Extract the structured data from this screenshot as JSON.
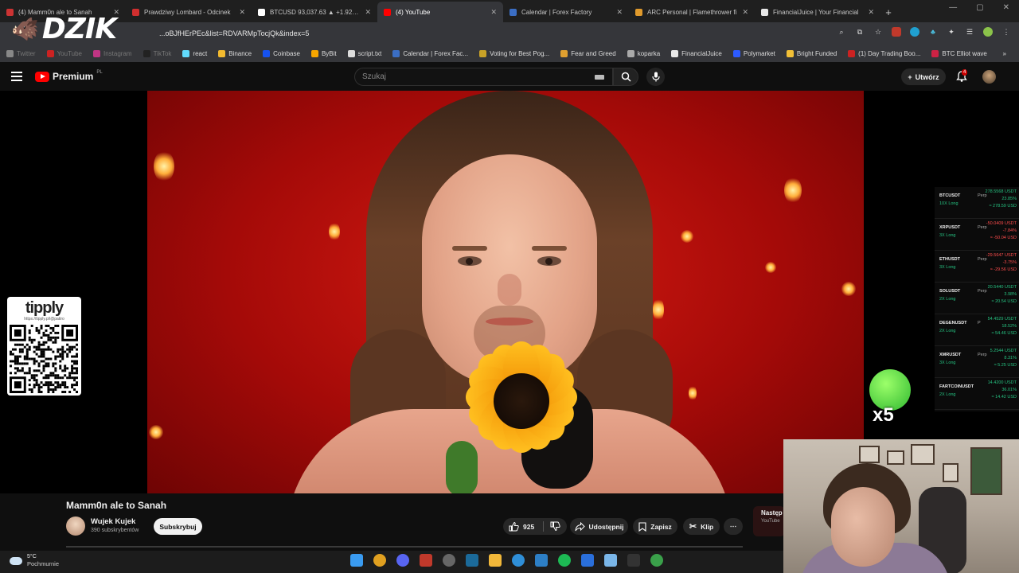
{
  "browser": {
    "tabs": [
      {
        "title": "(4) Mamm0n ale to Sanah",
        "color": "#cc3333",
        "active": false
      },
      {
        "title": "Prawdziwy Lombard - Odcinek",
        "color": "#d02f2f",
        "active": false
      },
      {
        "title": "BTCUSD 93,037.63 ▲ +1.92% B",
        "color": "#ffffff",
        "active": false
      },
      {
        "title": "(4) YouTube",
        "color": "#ff0000",
        "active": true
      },
      {
        "title": "Calendar | Forex Factory",
        "color": "#3b6ec4",
        "active": false
      },
      {
        "title": "ARC Personal | Flamethrower fi",
        "color": "#e09a2c",
        "active": false
      },
      {
        "title": "FinancialJuice | Your Financial",
        "color": "#e8e8e8",
        "active": false
      }
    ],
    "new_tab": "+",
    "url": "...oBJfHErPEc&list=RDVARMpTocjQk&index=5",
    "bookmarks": [
      {
        "label": "Twitter",
        "color": "#888888",
        "dim": true
      },
      {
        "label": "YouTube",
        "color": "#cc2222",
        "dim": true
      },
      {
        "label": "Instagram",
        "color": "#c13584",
        "dim": true
      },
      {
        "label": "TikTok",
        "color": "#222222",
        "dim": true
      },
      {
        "label": "react",
        "color": "#61dafb",
        "dim": false
      },
      {
        "label": "Binance",
        "color": "#f3ba2f",
        "dim": false
      },
      {
        "label": "Coinbase",
        "color": "#1652f0",
        "dim": false
      },
      {
        "label": "ByBit",
        "color": "#f7a600",
        "dim": false
      },
      {
        "label": "script.txt",
        "color": "#dddddd",
        "dim": false
      },
      {
        "label": "Calendar | Forex Fac...",
        "color": "#3b6ec4",
        "dim": false
      },
      {
        "label": "Voting for Best Pog...",
        "color": "#c9a227",
        "dim": false
      },
      {
        "label": "Fear and Greed",
        "color": "#e0a030",
        "dim": false
      },
      {
        "label": "koparka",
        "color": "#aaaaaa",
        "dim": false
      },
      {
        "label": "FinancialJuice",
        "color": "#e8e8e8",
        "dim": false
      },
      {
        "label": "Polymarket",
        "color": "#2d5bff",
        "dim": false
      },
      {
        "label": "Bright Funded",
        "color": "#f2c037",
        "dim": false
      },
      {
        "label": "(1) Day Trading Boo...",
        "color": "#cc2222",
        "dim": false
      },
      {
        "label": "BTC Elliot wave",
        "color": "#cc2244",
        "dim": false
      }
    ]
  },
  "overlay_logo": "DZIK",
  "youtube": {
    "logo_text": "Premium",
    "logo_region": "PL",
    "search_placeholder": "Szukaj",
    "create_label": "Utwórz",
    "notifications": "4",
    "video": {
      "title": "Mamm0n ale to Sanah",
      "channel": "Wujek Kujek",
      "subscribers": "390 subskrybentów",
      "subscribe_label": "Subskrybuj",
      "likes": "925",
      "share_label": "Udostępnij",
      "save_label": "Zapisz",
      "clip_label": "Klip",
      "more_label": "⋯"
    },
    "up_next": {
      "label": "Następ",
      "source": "YouTube"
    }
  },
  "tipply": {
    "brand": "tipply",
    "url": "https://tipply.pl/@patiro"
  },
  "positions": [
    {
      "symbol": "BTCUSDT",
      "perp": "Perp",
      "lev": "10X Long",
      "v1": "278.5568 USDT",
      "v2": "23.85%",
      "v3": "≈ 278.59 USD",
      "up": true
    },
    {
      "symbol": "XRPUSDT",
      "perp": "Perp",
      "lev": "3X Long",
      "v1": "-50.0409 USDT",
      "v2": "-7.84%",
      "v3": "≈ -50.04 USD",
      "up": false
    },
    {
      "symbol": "ETHUSDT",
      "perp": "Perp",
      "lev": "3X Long",
      "v1": "-29.5647 USDT",
      "v2": "-3.75%",
      "v3": "≈ -29.56 USD",
      "up": false
    },
    {
      "symbol": "SOLUSDT",
      "perp": "Perp",
      "lev": "2X Long",
      "v1": "20.5440 USDT",
      "v2": "3.98%",
      "v3": "≈ 20.54 USD",
      "up": true
    },
    {
      "symbol": "DEGENUSDT",
      "perp": "P",
      "lev": "2X Long",
      "v1": "54.4529 USDT",
      "v2": "18.52%",
      "v3": "≈ 54.46 USD",
      "up": true
    },
    {
      "symbol": "XMRUSDT",
      "perp": "Perp",
      "lev": "3X Long",
      "v1": "5.2544 USDT",
      "v2": "8.31%",
      "v3": "≈ 5.25 USD",
      "up": true
    },
    {
      "symbol": "FARTCOINUSDT",
      "perp": "",
      "lev": "2X Long",
      "v1": "14.4200 USDT",
      "v2": "36.01%",
      "v3": "≈ 14.42 USD",
      "up": true
    }
  ],
  "emote": {
    "multiplier": "x5"
  },
  "taskbar": {
    "weather_temp": "5°C",
    "weather_desc": "Pochmurnie",
    "icons": [
      {
        "name": "start",
        "color": "#3a9bf0"
      },
      {
        "name": "chrome",
        "color": "#e0a020"
      },
      {
        "name": "discord",
        "color": "#5865f2"
      },
      {
        "name": "app",
        "color": "#c0392b"
      },
      {
        "name": "obs",
        "color": "#666666"
      },
      {
        "name": "steam",
        "color": "#1b6a9a"
      },
      {
        "name": "explorer",
        "color": "#f2b83a"
      },
      {
        "name": "edge",
        "color": "#2f8fd8"
      },
      {
        "name": "vscode",
        "color": "#2d7fc6"
      },
      {
        "name": "spotify",
        "color": "#1db954"
      },
      {
        "name": "store",
        "color": "#2a6fdb"
      },
      {
        "name": "notepad",
        "color": "#7ab6e8"
      },
      {
        "name": "terminal",
        "color": "#333333"
      },
      {
        "name": "maps",
        "color": "#3aa04a"
      }
    ]
  },
  "colors": {
    "yt_red": "#ff0000",
    "up": "#26c281",
    "down": "#ff4d4d"
  }
}
